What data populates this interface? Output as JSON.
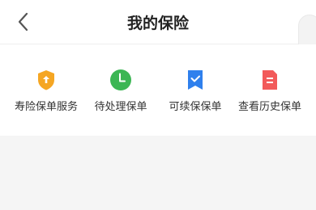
{
  "header": {
    "title": "我的保险"
  },
  "services": [
    {
      "label": "寿险保单服务",
      "icon": "shield-icon",
      "color": "#F5A623"
    },
    {
      "label": "待处理保单",
      "icon": "clock-icon",
      "color": "#3CB654"
    },
    {
      "label": "可续保保单",
      "icon": "bookmark-check-icon",
      "color": "#2F80ED"
    },
    {
      "label": "查看历史保单",
      "icon": "document-icon",
      "color": "#F25A5A"
    }
  ]
}
